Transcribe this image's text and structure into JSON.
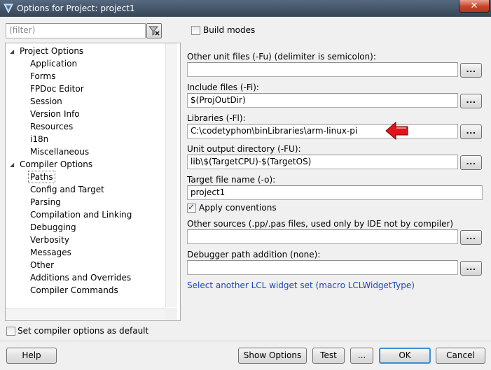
{
  "window": {
    "title": "Options for Project: project1",
    "close_label": "✕"
  },
  "filter": {
    "placeholder": "(filter)"
  },
  "build_modes": {
    "label": "Build modes",
    "checked": false
  },
  "tree": {
    "root_project": "Project Options",
    "project_items": [
      "Application",
      "Forms",
      "FPDoc Editor",
      "Session",
      "Version Info",
      "Resources",
      "i18n",
      "Miscellaneous"
    ],
    "root_compiler": "Compiler Options",
    "compiler_items": [
      "Paths",
      "Config and Target",
      "Parsing",
      "Compilation and Linking",
      "Debugging",
      "Verbosity",
      "Messages",
      "Other",
      "Additions and Overrides",
      "Compiler Commands"
    ],
    "selected": "Paths"
  },
  "paths": {
    "other_units": {
      "label": "Other unit files (-Fu) (delimiter is semicolon):",
      "value": ""
    },
    "include_files": {
      "label": "Include files (-Fi):",
      "value": "$(ProjOutDir)"
    },
    "libraries": {
      "label": "Libraries (-Fl):",
      "value": "C:\\codetyphon\\binLibraries\\arm-linux-pi"
    },
    "unit_output": {
      "label": "Unit output directory (-FU):",
      "value": "lib\\$(TargetCPU)-$(TargetOS)"
    },
    "target_file": {
      "label": "Target file name (-o):",
      "value": "project1"
    },
    "apply_conventions": {
      "label": "Apply conventions",
      "checked": true
    },
    "other_sources": {
      "label": "Other sources (.pp/.pas files, used only by IDE not by compiler)",
      "value": ""
    },
    "debugger_path": {
      "label": "Debugger path addition (none):",
      "value": ""
    },
    "browse_label": "...",
    "lcl_link": "Select another LCL widget set (macro LCLWidgetType)"
  },
  "set_default": {
    "label": "Set compiler options as default",
    "checked": false
  },
  "buttons": {
    "help": "Help",
    "show_options": "Show Options",
    "test": "Test",
    "more": "...",
    "ok": "OK",
    "cancel": "Cancel"
  },
  "colors": {
    "arrow": "#e0141a",
    "link": "#1d46bd",
    "title_bar": "#4a5b70"
  }
}
